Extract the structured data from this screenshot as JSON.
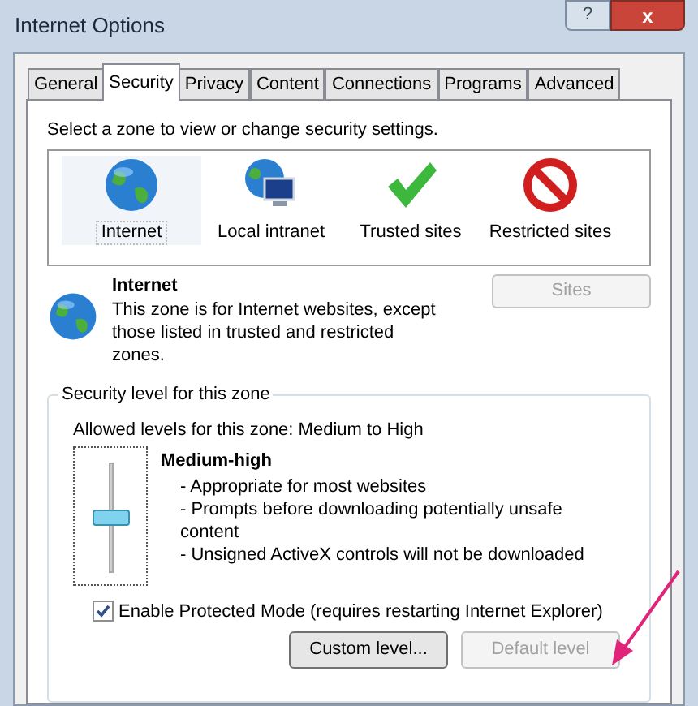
{
  "window": {
    "title": "Internet Options",
    "help_button": "?",
    "close_button": "x"
  },
  "tabs": [
    {
      "label": "General",
      "selected": false
    },
    {
      "label": "Security",
      "selected": true
    },
    {
      "label": "Privacy",
      "selected": false
    },
    {
      "label": "Content",
      "selected": false
    },
    {
      "label": "Connections",
      "selected": false
    },
    {
      "label": "Programs",
      "selected": false
    },
    {
      "label": "Advanced",
      "selected": false
    }
  ],
  "zones_prompt": "Select a zone to view or change security settings.",
  "zones": [
    {
      "kind": "globe",
      "label": "Internet",
      "selected": true
    },
    {
      "kind": "intranet",
      "label": "Local intranet",
      "selected": false
    },
    {
      "kind": "check",
      "label": "Trusted sites",
      "selected": false
    },
    {
      "kind": "forbidden",
      "label": "Restricted sites",
      "selected": false
    }
  ],
  "zone_info": {
    "title": "Internet",
    "description": "This zone is for Internet websites, except those listed in trusted and restricted zones.",
    "sites_button": {
      "label": "Sites",
      "disabled": true
    }
  },
  "security_level": {
    "legend": "Security level for this zone",
    "allowed": "Allowed levels for this zone: Medium to High",
    "slider": {
      "level": 0.5
    },
    "level_name": "Medium-high",
    "details": [
      "- Appropriate for most websites",
      "- Prompts before downloading potentially unsafe content",
      "- Unsigned ActiveX controls will not be downloaded"
    ],
    "protected_mode": {
      "label": "Enable Protected Mode (requires restarting Internet Explorer)",
      "checked": true
    },
    "buttons": [
      {
        "label": "Custom level...",
        "disabled": false
      },
      {
        "label": "Default level",
        "disabled": true
      }
    ]
  }
}
